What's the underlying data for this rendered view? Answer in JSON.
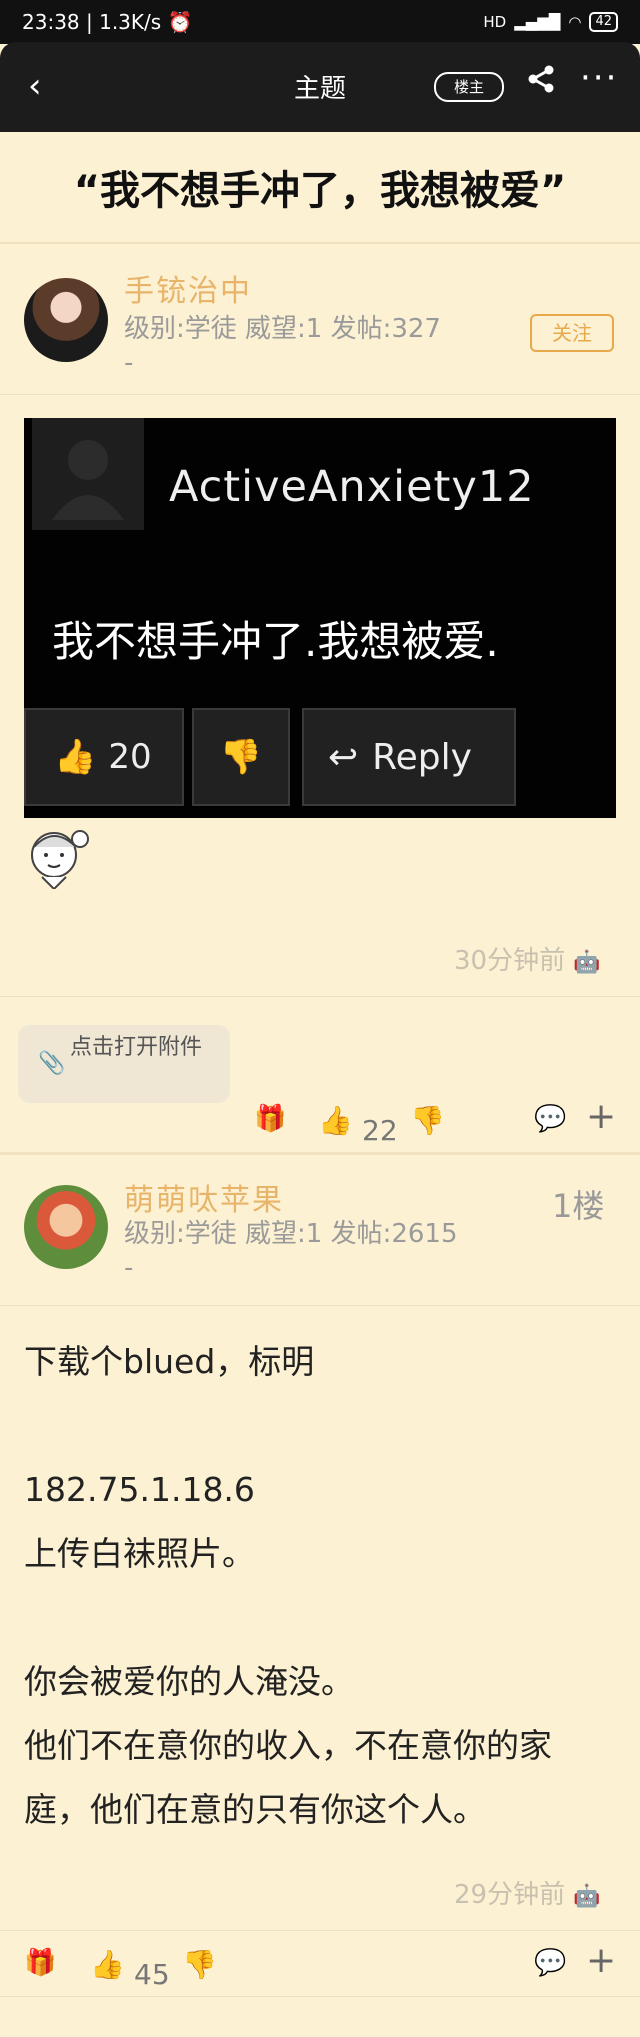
{
  "status_bar": {
    "time_speed": "23:38 | 1.3K/s ⏰",
    "signal": "HD",
    "battery": "42"
  },
  "nav": {
    "back_icon": "chevron-left-icon",
    "title": "主题",
    "owner_only": "楼主",
    "share_icon": "share-icon",
    "more_icon": "more-icon"
  },
  "thread": {
    "title": "“我不想手冲了，我想被爱”"
  },
  "posts": [
    {
      "username": "手铳治中",
      "info": "级别:学徒 威望:1 发帖:327",
      "info_extra": "-",
      "follow_label": "关注",
      "image": {
        "commenter": "ActiveAnxiety12",
        "comment": "我不想手冲了.我想被爱.",
        "likes": "20",
        "reply_label": "Reply"
      },
      "time": "30分钟前",
      "attachment_label": "点击打开附件",
      "vote_count": "22"
    },
    {
      "username": "萌萌呔苹果",
      "info": "级别:学徒 威望:1 发帖:2615",
      "info_extra": "-",
      "floor": "1楼",
      "content": "下载个blued，标明\n\n182.75.1.18.6\n上传白袜照片。\n\n你会被爱你的人淹没。\n他们不在意你的收入，不在意你的家\n庭，他们在意的只有你这个人。",
      "time": "29分钟前",
      "vote_count": "45"
    }
  ],
  "colors": {
    "background": "#fdf1d3",
    "username": "#e7b46a",
    "follow": "#e7a94a",
    "navbar": "#1c1c1c"
  }
}
